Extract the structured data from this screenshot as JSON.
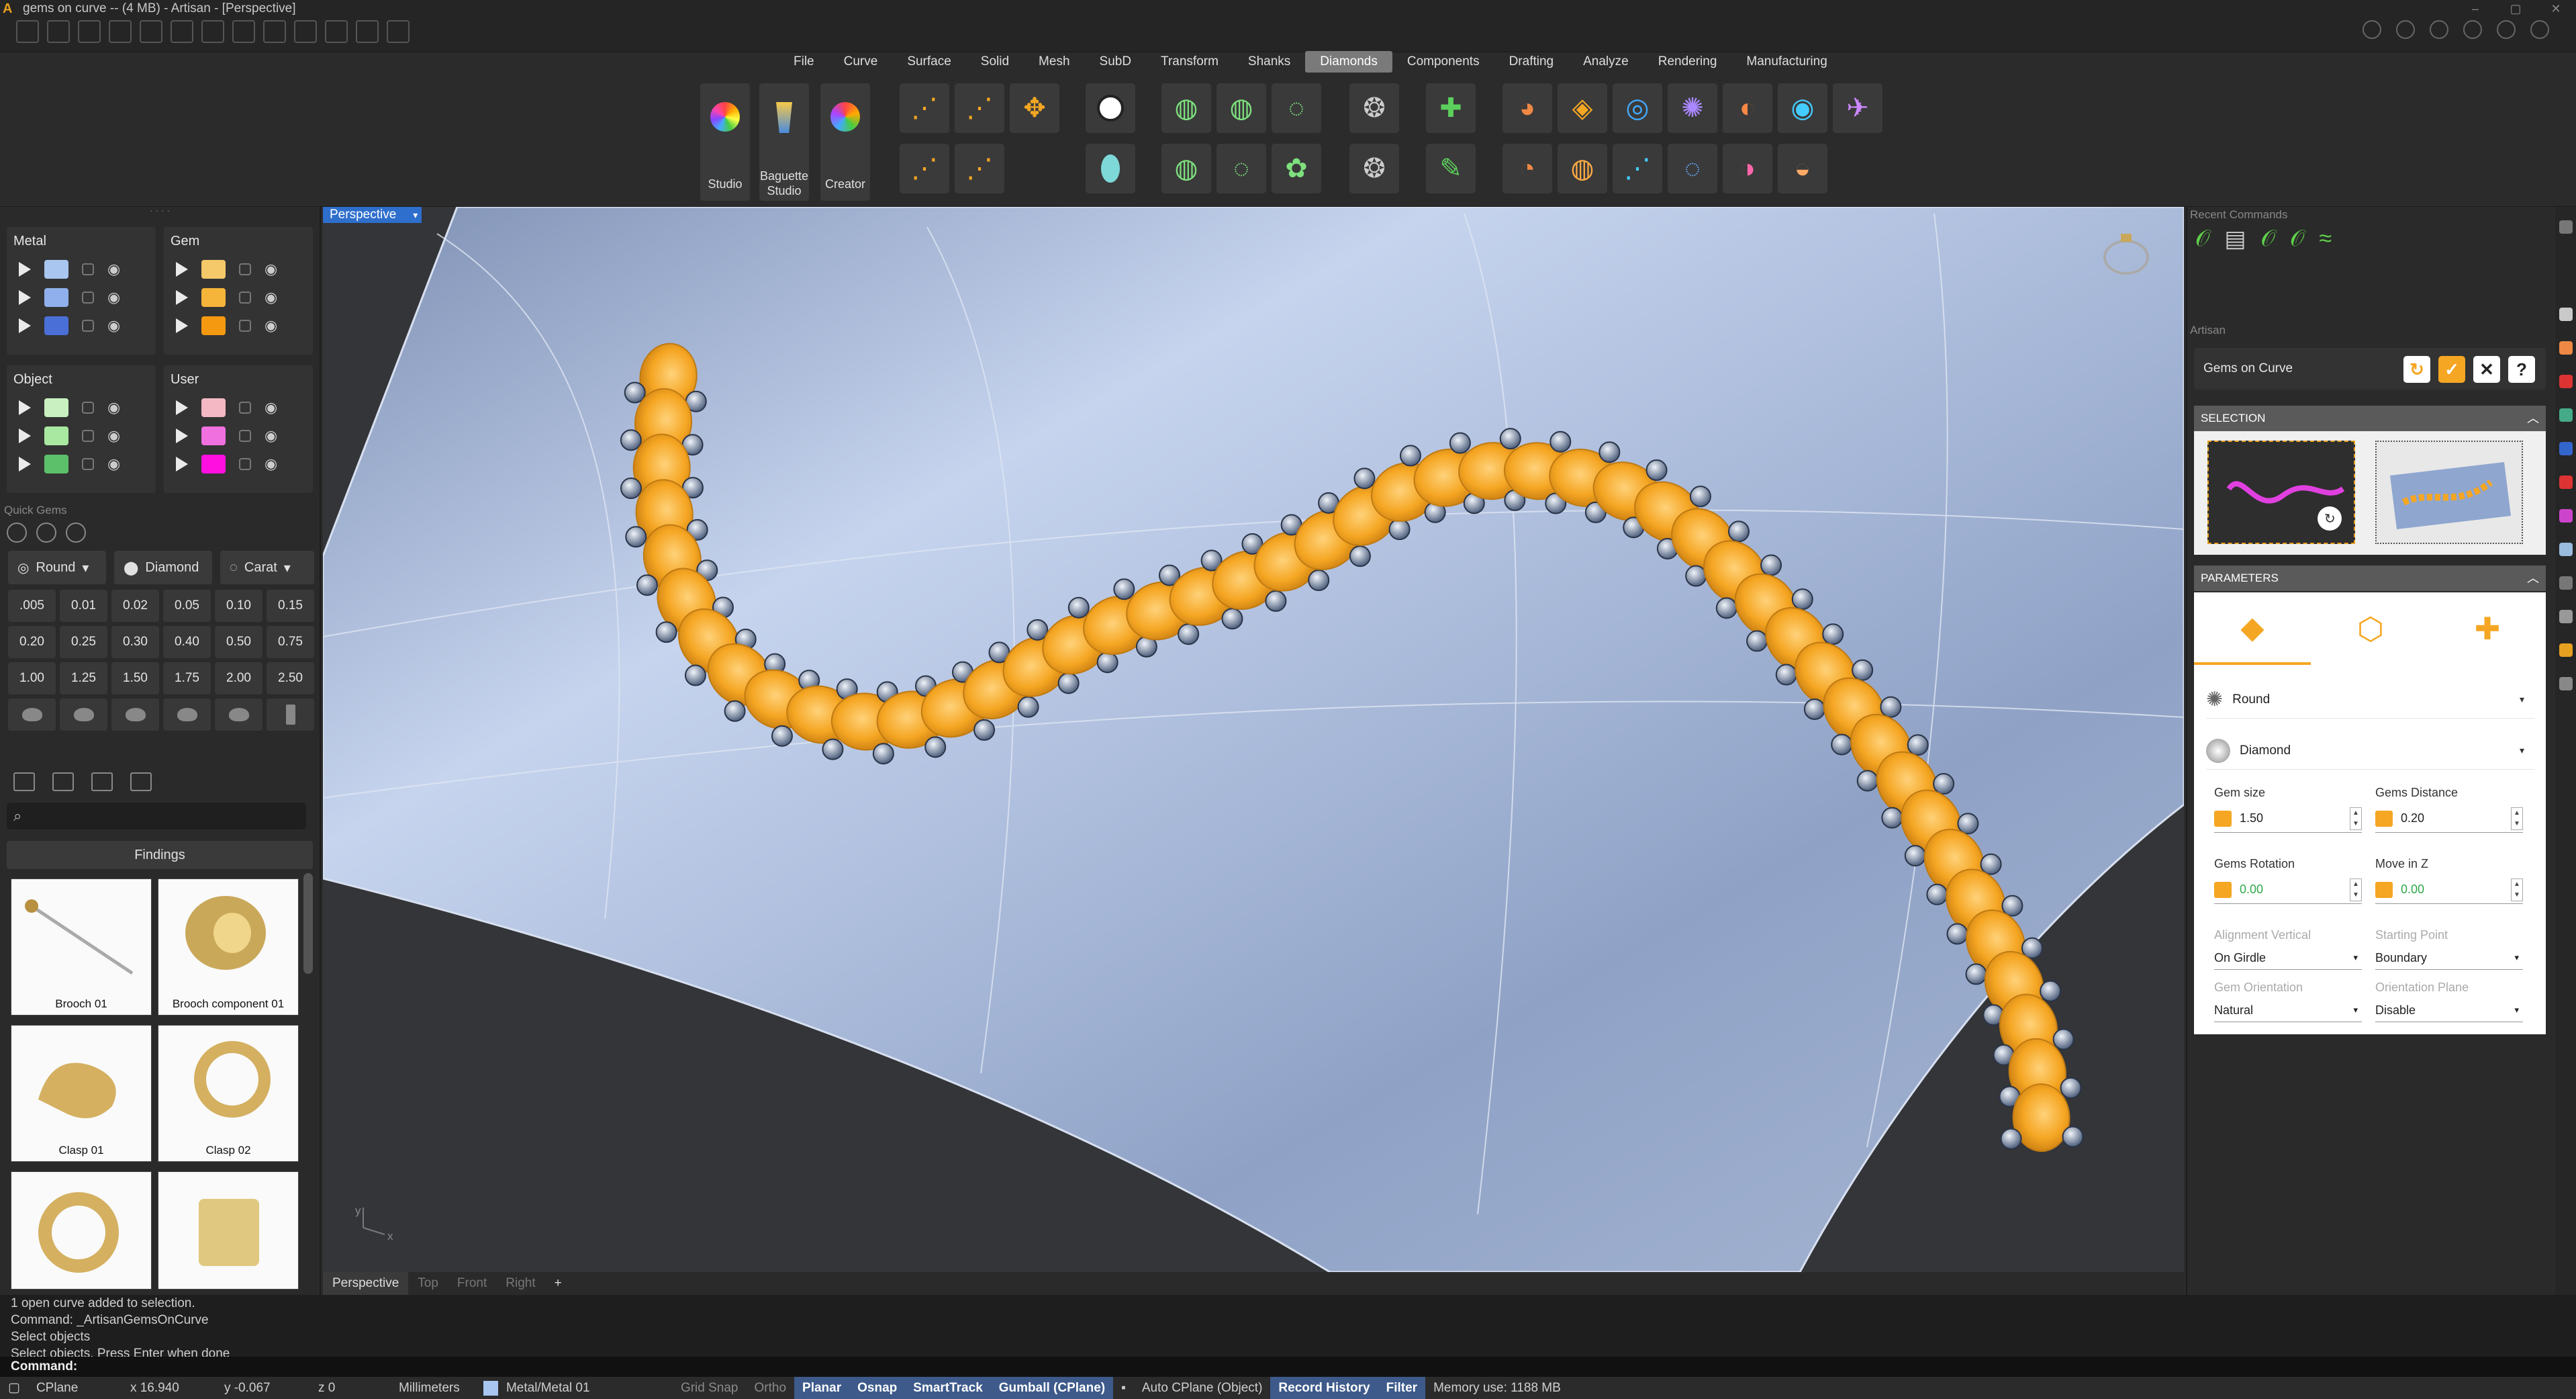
{
  "window": {
    "title": "gems on curve -- (4 MB) - Artisan - [Perspective]",
    "controls": [
      "–",
      "▢",
      "✕"
    ]
  },
  "menu": {
    "items": [
      "File",
      "Curve",
      "Surface",
      "Solid",
      "Mesh",
      "SubD",
      "Transform",
      "Shanks",
      "Diamonds",
      "Components",
      "Drafting",
      "Analyze",
      "Rendering",
      "Manufacturing"
    ],
    "active": "Diamonds"
  },
  "ribbon": {
    "studio": "Studio",
    "baguette": "Baguette Studio",
    "creator": "Creator"
  },
  "layers": {
    "groups": [
      {
        "name": "Metal",
        "colors": [
          "#a8c6f0",
          "#8fb0ec",
          "#4a6fd6"
        ]
      },
      {
        "name": "Gem",
        "colors": [
          "#f5c86a",
          "#f5b43a",
          "#f59a10"
        ]
      },
      {
        "name": "Object",
        "colors": [
          "#c8f0c0",
          "#a8e8a0",
          "#5cc06a"
        ]
      },
      {
        "name": "User",
        "colors": [
          "#f4b8c4",
          "#f070e0",
          "#ff10e0"
        ]
      }
    ]
  },
  "quick_gems": {
    "title": "Quick Gems",
    "shape": "Round",
    "material": "Diamond",
    "unit": "Carat",
    "sizes": [
      ".005",
      "0.01",
      "0.02",
      "0.05",
      "0.10",
      "0.15",
      "0.20",
      "0.25",
      "0.30",
      "0.40",
      "0.50",
      "0.75",
      "1.00",
      "1.25",
      "1.50",
      "1.75",
      "2.00",
      "2.50"
    ]
  },
  "library": {
    "search_placeholder": "",
    "category": "Findings",
    "items": [
      "Brooch 01",
      "Brooch component 01",
      "Clasp 01",
      "Clasp 02",
      "",
      ""
    ]
  },
  "viewport": {
    "active_view": "Perspective",
    "tabs": [
      "Perspective",
      "Top",
      "Front",
      "Right",
      "+"
    ],
    "axis_x": "x",
    "axis_y": "y"
  },
  "recent_commands": {
    "title": "Recent Commands",
    "count": 5
  },
  "artisan_panel": {
    "title": "Artisan",
    "command": "Gems on Curve",
    "selection_title": "SELECTION",
    "parameters_title": "PARAMETERS",
    "gem_shape": "Round",
    "gem_material": "Diamond",
    "gem_size_label": "Gem size",
    "gem_size": "1.50",
    "gems_distance_label": "Gems Distance",
    "gems_distance": "0.20",
    "gems_rotation_label": "Gems Rotation",
    "gems_rotation": "0.00",
    "move_in_z_label": "Move in Z",
    "move_in_z": "0.00",
    "alignment_vertical_label": "Alignment Vertical",
    "alignment_vertical": "On Girdle",
    "starting_point_label": "Starting Point",
    "starting_point": "Boundary",
    "gem_orientation_label": "Gem Orientation",
    "gem_orientation": "Natural",
    "orientation_plane_label": "Orientation Plane",
    "orientation_plane": "Disable"
  },
  "command_history": [
    "1 open curve added to selection.",
    "Command: _ArtisanGemsOnCurve",
    "Select objects",
    "Select objects. Press Enter when done"
  ],
  "command_prompt": "Command:",
  "status": {
    "cplane": "CPlane",
    "x": "x 16.940",
    "y": "y -0.067",
    "z": "z 0",
    "units": "Millimeters",
    "layer": "Metal/Metal 01",
    "grid_snap": "Grid Snap",
    "ortho": "Ortho",
    "planar": "Planar",
    "osnap": "Osnap",
    "smarttrack": "SmartTrack",
    "gumball": "Gumball (CPlane)",
    "auto_cplane": "Auto CPlane (Object)",
    "record_history": "Record History",
    "filter": "Filter",
    "memory": "Memory use: 1188 MB"
  },
  "colors": {
    "accent": "#f5a623",
    "viewport_tab": "#2e6ecc",
    "gem": "#f5a623",
    "surface": "#b8c8e6"
  }
}
